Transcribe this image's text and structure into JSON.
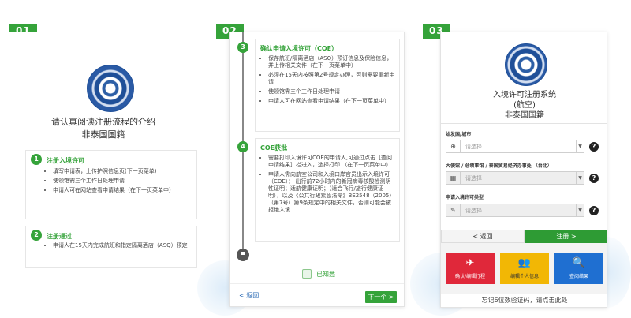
{
  "steps": {
    "one": "01",
    "two": "02",
    "three": "03"
  },
  "panel1": {
    "title": "请认真阅读注册流程的介绍",
    "subtitle": "非泰国国籍",
    "items": [
      {
        "num": "1",
        "title": "注册入境许可",
        "bullets": [
          "填写申请表，上传护照信息页(下一页菜单)",
          "使领馆需三个工作日处理申请",
          "申请人可在网站查看申请结果（在下一页菜单中）"
        ]
      },
      {
        "num": "2",
        "title": "注册通过",
        "bullets": [
          "申请人在15天内完成航班和指定隔离酒店（ASQ）预定"
        ]
      }
    ]
  },
  "panel2": {
    "items": [
      {
        "num": "3",
        "title": "确认申请入境许可（COE）",
        "bullets": [
          "保存航班/隔离酒店（ASQ）预订信息及保险信息，并上传相关文件（在下一页菜单中）",
          "必须在15天内按照第2号规定办理，否则需要重新申请",
          "使领馆需三个工作日处理申请",
          "申请人可在网站查看申请结果（在下一页菜单中）"
        ]
      },
      {
        "num": "4",
        "title": "COE获批",
        "bullets": [
          "需要打印入境许可COE的申请人,可通过点击［查阅申请结果］栏进入，选择打印 （在下一页菜单中）",
          "申请人需向航空公司和入境口岸官员出示入境许可（COE）： 出行前72小时内的新冠病毒核酸检测阴性证明；适航健康证明；（适合飞行/旅行健康证明），以及《公共行政紧急法令》BE2548（2005）（第7号）第9条规定中的相关文件，否则可能会被拒绝入境"
        ]
      }
    ],
    "agree_label": "已知悉",
    "back_label": "< 返回",
    "next_label": "下一个 >"
  },
  "panel3": {
    "title_line1": "入境许可注册系统",
    "title_line2": "(航空)",
    "title_line3": "非泰国国籍",
    "fields": [
      {
        "label": "始发国/城市",
        "placeholder": "请选择",
        "icon": "globe-icon"
      },
      {
        "label": "大使馆 / 总领事馆 / 泰国贸易经济办事处 （台北）",
        "placeholder": "请选择",
        "icon": "building-icon"
      },
      {
        "label": "申请入境许可类型",
        "placeholder": "请选择",
        "icon": "edit-icon"
      }
    ],
    "back_label": "< 返回",
    "register_label": "注册 >",
    "tiles": [
      {
        "label": "确认/编辑行程",
        "icon": "plane-icon",
        "color": "#e0283a"
      },
      {
        "label": "编辑个人信息",
        "icon": "people-icon",
        "color": "#f2b705"
      },
      {
        "label": "查阅结果",
        "icon": "search-icon",
        "color": "#1f6fd1"
      }
    ],
    "forgot_text": "忘记6位数验证码，请点击此处"
  },
  "colors": {
    "accent_green": "#35a33a",
    "link_blue": "#2d6cb5"
  }
}
